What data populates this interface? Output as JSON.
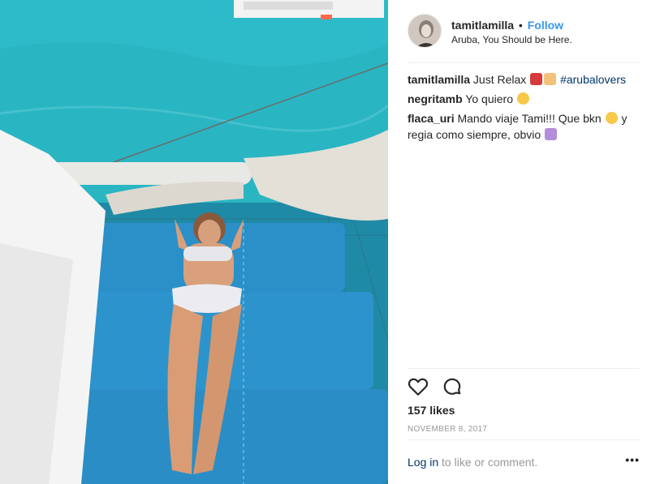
{
  "post": {
    "username": "tamitlamilla",
    "separator": "•",
    "follow_label": "Follow",
    "location": "Aruba, You Should be Here."
  },
  "comments": [
    {
      "user": "tamitlamilla",
      "text": "Just Relax",
      "hashtag": "#arubalovers"
    },
    {
      "user": "negritamb",
      "text": "Yo quiero"
    },
    {
      "user": "flaca_uri",
      "text": "Mando viaje Tami!!! Que bkn",
      "text2": "y regia como siempre, obvio"
    }
  ],
  "actions": {
    "like_icon": "heart-icon",
    "comment_icon": "comment-icon"
  },
  "likes": "157 likes",
  "date": "NOVEMBER 8, 2017",
  "footer": {
    "login_label": "Log in",
    "login_suffix": "to like or comment.",
    "more_label": "•••"
  },
  "colors": {
    "accent": "#3897f0",
    "link": "#003569",
    "muted": "#999999"
  }
}
